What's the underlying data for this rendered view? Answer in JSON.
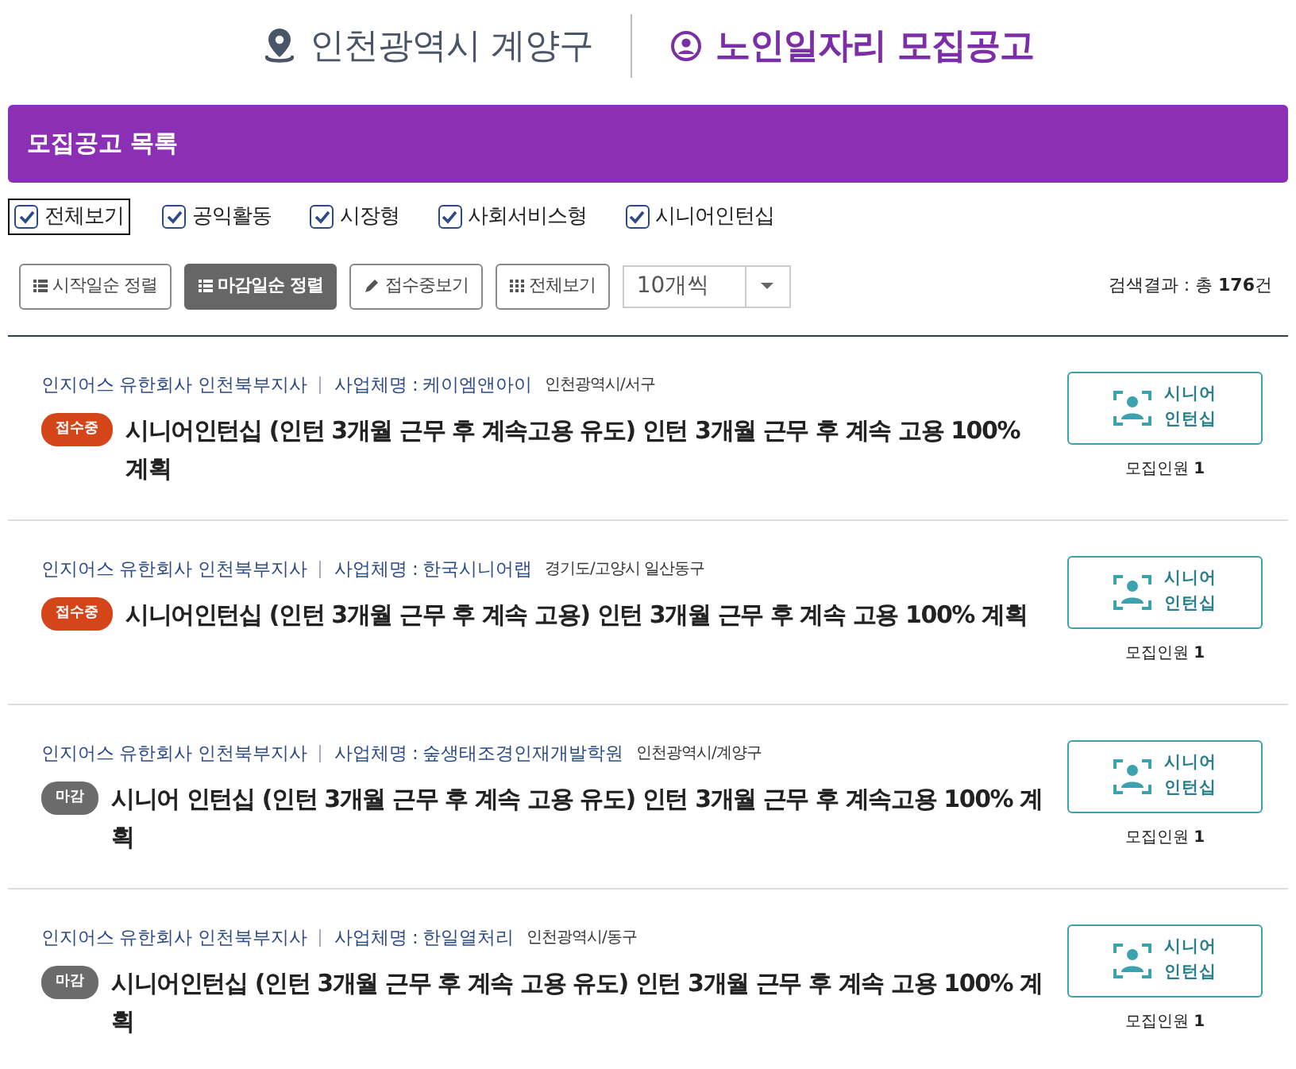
{
  "header": {
    "location": "인천광역시 계양구",
    "title": "노인일자리 모집공고"
  },
  "list_title": "모집공고 목록",
  "filters": [
    {
      "label": "전체보기",
      "checked": true,
      "focused": true
    },
    {
      "label": "공익활동",
      "checked": true,
      "focused": false
    },
    {
      "label": "시장형",
      "checked": true,
      "focused": false
    },
    {
      "label": "사회서비스형",
      "checked": true,
      "focused": false
    },
    {
      "label": "시니어인턴십",
      "checked": true,
      "focused": false
    }
  ],
  "sort_buttons": [
    {
      "label": "시작일순 정렬",
      "kind": "list",
      "selected": false
    },
    {
      "label": "마감일순 정렬",
      "kind": "list",
      "selected": true
    },
    {
      "label": "접수중보기",
      "kind": "pencil",
      "selected": false
    },
    {
      "label": "전체보기",
      "kind": "grid",
      "selected": false
    }
  ],
  "per_page": {
    "value": "10개씩"
  },
  "result": "검색결과 : 총 **176**건",
  "postings": [
    {
      "company": "인지어스 유한회사 인천북부지사",
      "business": "사업체명 : 케이엠앤아이",
      "region": "인천광역시/서구",
      "status": {
        "label": "접수중",
        "kind": "open"
      },
      "title": "시니어인턴십 (인턴 3개월 근무 후 계속고용 유도) 인턴 3개월 근무 후 계속 고용 100% 계획",
      "type_lines": [
        "시니어",
        "인턴십"
      ],
      "recruit": "모집인원 **1**"
    },
    {
      "company": "인지어스 유한회사 인천북부지사",
      "business": "사업체명 : 한국시니어랩",
      "region": "경기도/고양시 일산동구",
      "status": {
        "label": "접수중",
        "kind": "open"
      },
      "title": "시니어인턴십 (인턴 3개월 근무 후 계속 고용) 인턴 3개월 근무 후 계속 고용 100% 계획",
      "type_lines": [
        "시니어",
        "인턴십"
      ],
      "recruit": "모집인원 **1**"
    },
    {
      "company": "인지어스 유한회사 인천북부지사",
      "business": "사업체명 : 숲생태조경인재개발학원",
      "region": "인천광역시/계양구",
      "status": {
        "label": "마감",
        "kind": "closed"
      },
      "title": "시니어 인턴십 (인턴 3개월 근무 후 계속 고용 유도) 인턴 3개월 근무 후 계속고용 100% 계획",
      "type_lines": [
        "시니어",
        "인턴십"
      ],
      "recruit": "모집인원 **1**"
    },
    {
      "company": "인지어스 유한회사 인천북부지사",
      "business": "사업체명 : 한일열처리",
      "region": "인천광역시/동구",
      "status": {
        "label": "마감",
        "kind": "closed"
      },
      "title": "시니어인턴십 (인턴 3개월 근무 후 계속 고용 유도) 인턴 3개월 근무 후 계속 고용 100% 계획",
      "type_lines": [
        "시니어",
        "인턴십"
      ],
      "recruit": "모집인원 **1**"
    }
  ]
}
